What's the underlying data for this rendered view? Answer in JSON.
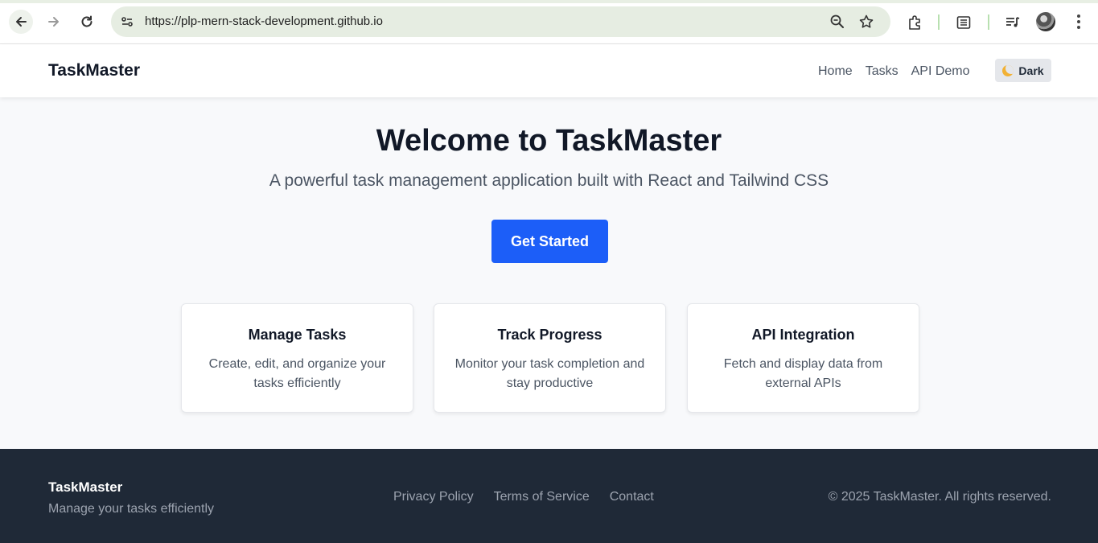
{
  "browser": {
    "url": "https://plp-mern-stack-development.github.io"
  },
  "navbar": {
    "brand": "TaskMaster",
    "links": [
      "Home",
      "Tasks",
      "API Demo"
    ],
    "theme_toggle_label": "Dark"
  },
  "hero": {
    "title": "Welcome to TaskMaster",
    "subtitle": "A powerful task management application built with React and Tailwind CSS",
    "cta_label": "Get Started"
  },
  "features": [
    {
      "title": "Manage Tasks",
      "description": "Create, edit, and organize your tasks efficiently"
    },
    {
      "title": "Track Progress",
      "description": "Monitor your task completion and stay productive"
    },
    {
      "title": "API Integration",
      "description": "Fetch and display data from external APIs"
    }
  ],
  "footer": {
    "brand": "TaskMaster",
    "tagline": "Manage your tasks efficiently",
    "links": [
      "Privacy Policy",
      "Terms of Service",
      "Contact"
    ],
    "copyright": "© 2025 TaskMaster. All rights reserved."
  },
  "colors": {
    "primary": "#1c5ef8",
    "footer_bg": "#1f2937",
    "page_bg": "#f8f9fb"
  },
  "icons": [
    "back-arrow-icon",
    "forward-arrow-icon",
    "reload-icon",
    "site-info-icon",
    "zoom-icon",
    "bookmark-star-icon",
    "extensions-icon",
    "reading-list-icon",
    "media-control-icon",
    "profile-avatar",
    "menu-kebab-icon",
    "moon-icon"
  ]
}
